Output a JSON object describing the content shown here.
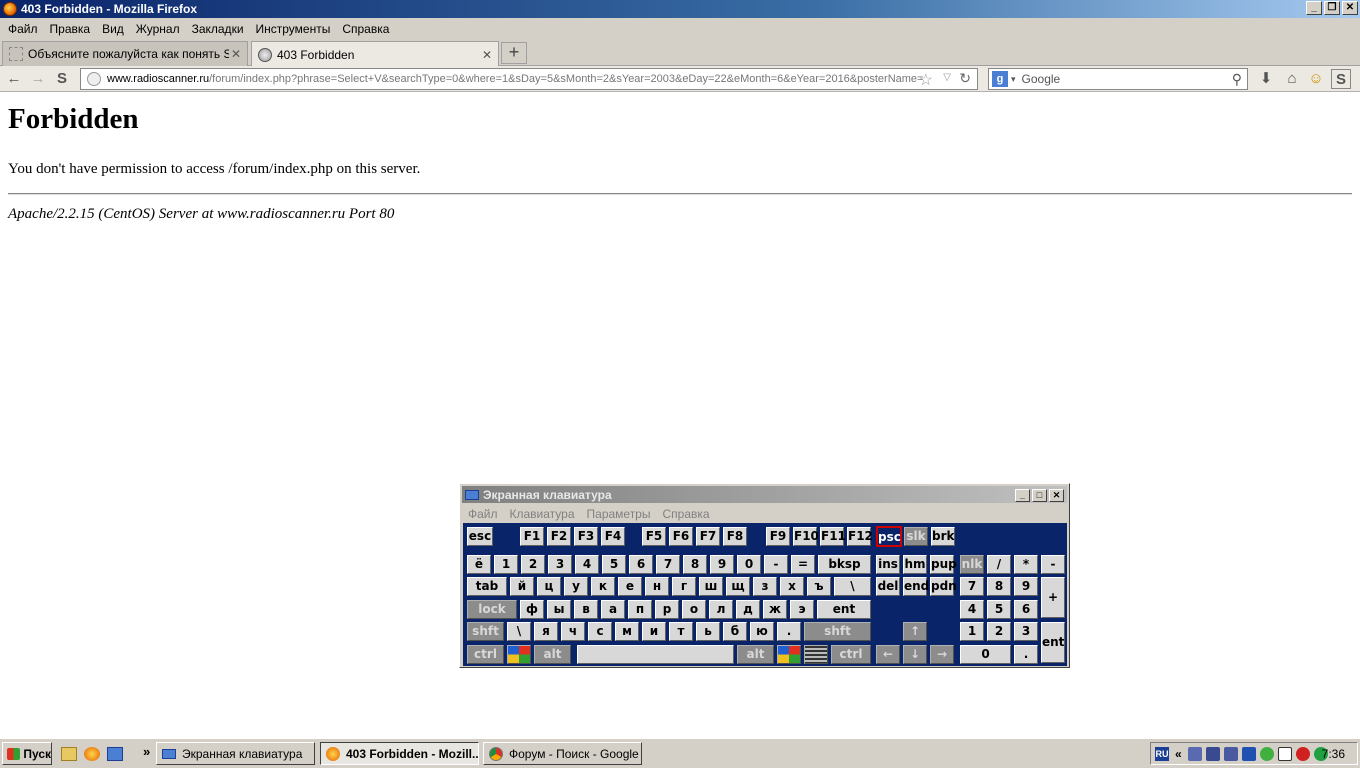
{
  "window": {
    "title": "403 Forbidden - Mozilla Firefox",
    "min": "_",
    "max": "❐",
    "close": "✕"
  },
  "menubar": [
    "Файл",
    "Правка",
    "Вид",
    "Журнал",
    "Закладки",
    "Инструменты",
    "Справка"
  ],
  "tabs": [
    {
      "label": "Объясните пожалуйста как понять Sig...",
      "close": "✕"
    },
    {
      "label": "403 Forbidden",
      "close": "✕"
    }
  ],
  "new_tab": "+",
  "nav": {
    "back": "←",
    "forward": "→",
    "sync": "S",
    "url_host": "www.radioscanner.ru",
    "url_path": "/forum/index.php?phrase=Select+V&searchType=0&where=1&sDay=5&sMonth=2&sYear=2003&eDay=22&eMonth=6&eYear=2016&posterName=",
    "star": "☆",
    "dropdown": "▽",
    "reload": "↻",
    "search_engine": "g",
    "search_dropdown": "▾",
    "search_placeholder": "Google",
    "search_glass": "⚲",
    "download": "⬇",
    "home": "⌂",
    "smiley": "☺",
    "sync2": "S"
  },
  "page": {
    "heading": "Forbidden",
    "message": "You don't have permission to access /forum/index.php on this server.",
    "address": "Apache/2.2.15 (CentOS) Server at www.radioscanner.ru Port 80"
  },
  "osk": {
    "title": "Экранная клавиатура",
    "menu": [
      "Файл",
      "Клавиатура",
      "Параметры",
      "Справка"
    ],
    "wbtn": [
      "_",
      "□",
      "✕"
    ],
    "keys": [
      "esc",
      "F1",
      "F2",
      "F3",
      "F4",
      "F5",
      "F6",
      "F7",
      "F8",
      "F9",
      "F10",
      "F11",
      "F12",
      "psc",
      "slk",
      "brk",
      "ё",
      "1",
      "2",
      "3",
      "4",
      "5",
      "6",
      "7",
      "8",
      "9",
      "0",
      "-",
      "=",
      "bksp",
      "ins",
      "hm",
      "pup",
      "nlk",
      "/",
      "*",
      "-",
      "tab",
      "й",
      "ц",
      "у",
      "к",
      "е",
      "н",
      "г",
      "ш",
      "щ",
      "з",
      "х",
      "ъ",
      "\\",
      "del",
      "end",
      "pdn",
      "7",
      "8",
      "9",
      "+",
      "lock",
      "ф",
      "ы",
      "в",
      "а",
      "п",
      "р",
      "о",
      "л",
      "д",
      "ж",
      "э",
      "ent",
      "4",
      "5",
      "6",
      "shft",
      "\\",
      "я",
      "ч",
      "с",
      "м",
      "и",
      "т",
      "ь",
      "б",
      "ю",
      ".",
      "shft",
      "↑",
      "1",
      "2",
      "3",
      "ent",
      "ctrl",
      "alt",
      "alt",
      "ctrl",
      "←",
      "↓",
      "→",
      "0",
      "."
    ]
  },
  "taskbar": {
    "start": "Пуск",
    "chevron": "»",
    "items": [
      "Экранная клавиатура",
      "403 Forbidden - Mozill...",
      "Форум - Поиск - Google ..."
    ],
    "lang": "RU",
    "tray_chevron": "«",
    "clock": "7:36"
  }
}
